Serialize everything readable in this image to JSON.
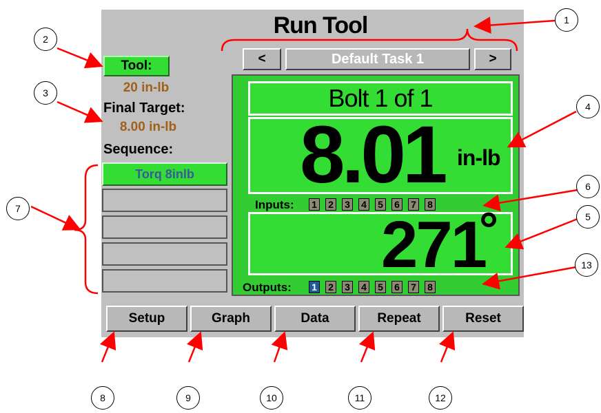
{
  "screen": {
    "title": "Run Tool",
    "task": {
      "prev": "<",
      "name": "Default Task 1",
      "next": ">"
    },
    "tool": {
      "label": "Tool:",
      "value": "20 in-lb"
    },
    "final_target": {
      "label": "Final Target:",
      "value": "8.00 in-lb"
    },
    "sequence": {
      "label": "Sequence:",
      "items": [
        "Torq 8inlb",
        "",
        "",
        "",
        ""
      ]
    },
    "bolt": "Bolt 1 of 1",
    "torque": {
      "value": "8.01",
      "unit": "in-lb"
    },
    "angle": {
      "value": "271",
      "unit": "°"
    },
    "inputs": {
      "label": "Inputs:",
      "items": [
        "1",
        "2",
        "3",
        "4",
        "5",
        "6",
        "7",
        "8"
      ]
    },
    "outputs": {
      "label": "Outputs:",
      "items": [
        "1",
        "2",
        "3",
        "4",
        "5",
        "6",
        "7",
        "8"
      ],
      "active": [
        1
      ]
    },
    "buttons": {
      "setup": "Setup",
      "graph": "Graph",
      "data": "Data",
      "repeat": "Repeat",
      "reset": "Reset"
    }
  },
  "callouts": [
    "1",
    "2",
    "3",
    "4",
    "5",
    "6",
    "7",
    "8",
    "9",
    "10",
    "11",
    "12",
    "13"
  ],
  "colors": {
    "screen_bg": "#c0c0c0",
    "green": "#33dd33",
    "value_brown": "#a0601a",
    "arrow_red": "#ff0000",
    "active_output": "#1a5aa0"
  }
}
